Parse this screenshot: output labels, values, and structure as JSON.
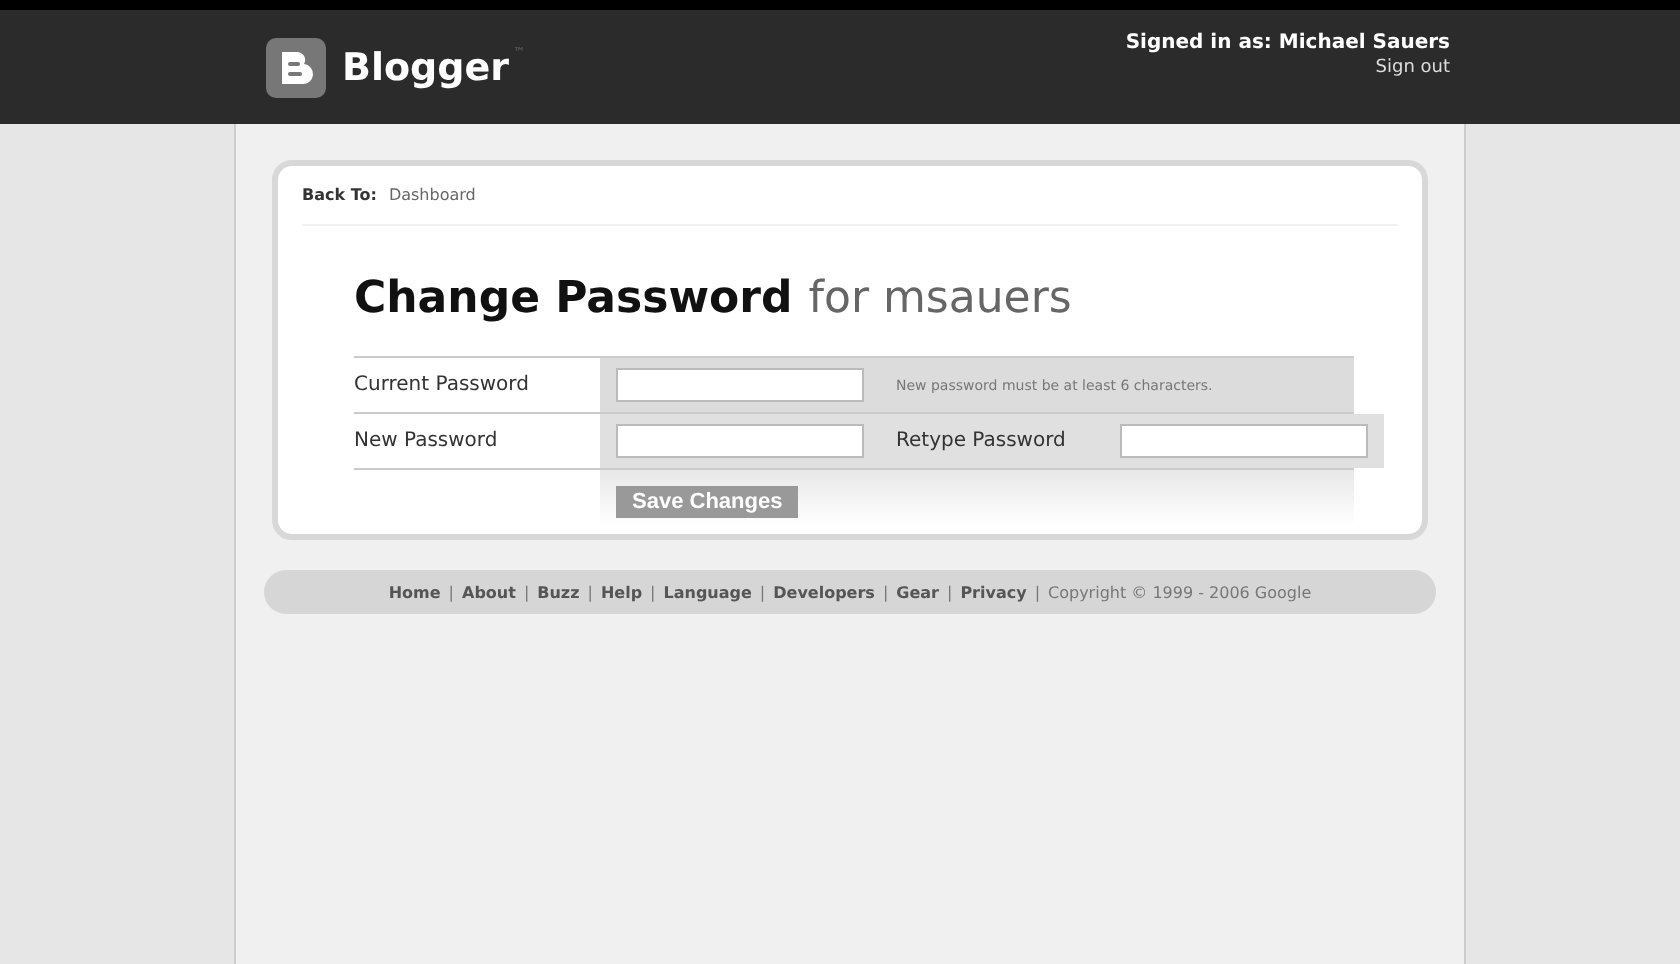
{
  "header": {
    "logo": "Blogger",
    "trademark": "™",
    "signed_in_label": "Signed in as:",
    "user": "Michael Sauers",
    "sign_out": "Sign out"
  },
  "breadcrumb": {
    "label": "Back To:",
    "link": "Dashboard"
  },
  "heading": {
    "title": "Change Password",
    "subtitle": "for msauers"
  },
  "form": {
    "rows": [
      {
        "label": "Current Password",
        "value": "",
        "note": "New password must be at least 6 characters."
      },
      {
        "label": "New Password",
        "value": "",
        "second_label": "Retype Password",
        "second_value": ""
      }
    ],
    "button": "Save Changes"
  },
  "footer": {
    "separator": "|",
    "links": [
      "Home",
      "About",
      "Buzz",
      "Help",
      "Language",
      "Developers",
      "Gear",
      "Privacy"
    ],
    "copyright": "Copyright © 1999 - 2006 Google"
  }
}
